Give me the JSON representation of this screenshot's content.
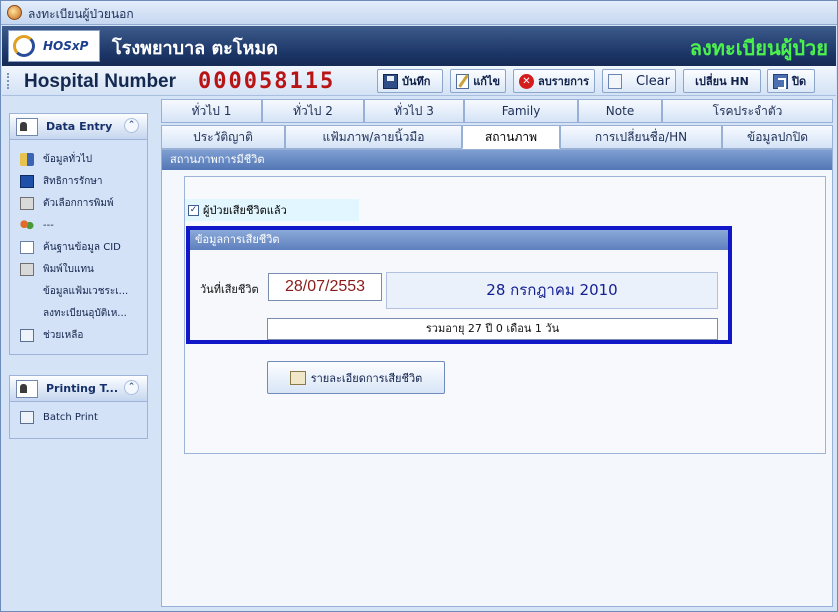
{
  "window": {
    "title": "ลงทะเบียนผู้ป่วยนอก"
  },
  "banner": {
    "logo_text": "HOSxP",
    "hospital_name": "โรงพยาบาล ตะโหมด",
    "module_title": "ลงทะเบียนผู้ป่วย"
  },
  "toolbar": {
    "hn_label": "Hospital Number",
    "hn_value": "000058115",
    "save": "บันทึก",
    "edit": "แก้ไข",
    "delete": "ลบรายการ",
    "clear": "Clear",
    "change_hn": "เปลี่ยน HN",
    "close": "ปิด"
  },
  "sidebar": {
    "data_entry": {
      "title": "Data Entry",
      "items": [
        {
          "label": "ข้อมูลทั่วไป",
          "icon": "book-icon"
        },
        {
          "label": "สิทธิการรักษา",
          "icon": "rights-icon"
        },
        {
          "label": "ตัวเลือกการพิมพ์",
          "icon": "printer-icon"
        },
        {
          "label": "---",
          "icon": "people-icon"
        },
        {
          "label": "ค้นฐานข้อมูล CID",
          "icon": "search-doc-icon"
        },
        {
          "label": "พิมพ์ใบแทน",
          "icon": "printer-icon"
        },
        {
          "label": "ข้อมูลแฟ้มเวชระเ...",
          "icon": ""
        },
        {
          "label": "ลงทะเบียนอุบัติเห...",
          "icon": ""
        },
        {
          "label": "ช่วยเหลือ",
          "icon": "card-icon"
        }
      ]
    },
    "printing": {
      "title": "Printing T...",
      "items": [
        {
          "label": "Batch Print",
          "icon": "card-icon"
        }
      ]
    }
  },
  "tabs": {
    "row1": [
      "ทั่วไป 1",
      "ทั่วไป 2",
      "ทั่วไป 3",
      "Family",
      "Note",
      "โรคประจำตัว"
    ],
    "row2": [
      "ประวัติญาติ",
      "แฟ้มภาพ/ลายนิ้วมือ",
      "สถานภาพ",
      "การเปลี่ยนชื่อ/HN",
      "ข้อมูลปกปิด"
    ],
    "active": "สถานภาพ"
  },
  "status": {
    "section_title": "สถานภาพการมีชีวิต",
    "deceased_label": "ผู้ป่วยเสียชีวิตแล้ว",
    "deceased_checked": true,
    "death_section_title": "ข้อมูลการเสียชีวิต",
    "death_date_label": "วันที่เสียชีวิต",
    "death_date": "28/07/2553",
    "death_date_long": "28 กรกฎาคม 2010",
    "age_text": "รวมอายุ 27 ปี 0 เดือน 1 วัน",
    "detail_button": "รายละเอียดการเสียชีวิต"
  }
}
